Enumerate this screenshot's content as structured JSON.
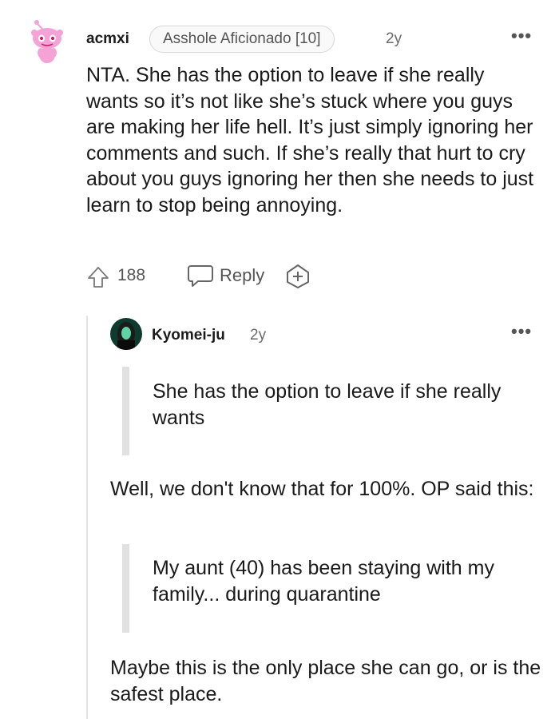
{
  "top_comment": {
    "username": "acmxi",
    "flair": "Asshole Aficionado [10]",
    "time": "2y",
    "more": "•••",
    "body": "NTA. She has the option to leave if she really wants so it’s not like she’s stuck where you guys are making her life hell. It’s just simply ignoring her comments and such. If she’s really that hurt to cry about you guys ignoring her then she needs to just learn to stop being annoying.",
    "score": "188",
    "reply_label": "Reply"
  },
  "reply_comment": {
    "username": "Kyomei-ju",
    "time": "2y",
    "more": "•••",
    "quote1": "She has the option to leave if she really wants",
    "para1": "Well, we don't know that for 100%. OP said this:",
    "quote2": "My aunt (40) has been staying with my family... during quarantine",
    "para2": "Maybe this is the only place she can go, or is the safest place."
  },
  "icons": {
    "avatar1": "snoo-avatar-icon",
    "upvote": "upvote-arrow-icon",
    "reply": "speech-bubble-icon",
    "award": "add-award-icon"
  },
  "colors": {
    "avatar_pink": "#f5a3d6",
    "text": "#1a1a1b",
    "muted": "#6b6b6b",
    "quote_bar": "#e1e1e1"
  }
}
